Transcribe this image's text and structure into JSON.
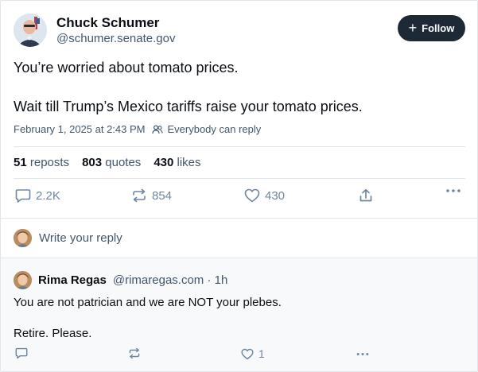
{
  "author": {
    "name": "Chuck Schumer",
    "handle": "@schumer.senate.gov"
  },
  "follow_label": "Follow",
  "post": {
    "line1": "You’re worried about tomato prices.",
    "line2": "Wait till Trump’s Mexico tariffs raise your tomato prices.",
    "timestamp": "February 1, 2025 at 2:43 PM",
    "reply_setting": "Everybody can reply"
  },
  "stats": {
    "reposts_count": "51",
    "reposts_label": "reposts",
    "quotes_count": "803",
    "quotes_label": "quotes",
    "likes_count": "430",
    "likes_label": "likes"
  },
  "actions": {
    "reply_count": "2.2K",
    "repost_count": "854",
    "like_count": "430"
  },
  "reply_prompt": "Write your reply",
  "reply": {
    "name": "Rima Regas",
    "handle": "@rimaregas.com",
    "time": "· 1h",
    "line1": "You are not patrician and we are NOT your plebes.",
    "line2": "Retire. Please.",
    "like_count": "1"
  },
  "icons": {
    "reply": "speech-bubble-icon",
    "repost": "repost-arrows-icon",
    "like": "heart-icon",
    "share": "share-upload-icon",
    "more": "ellipsis-icon",
    "people": "people-icon",
    "plus": "plus-icon"
  },
  "colors": {
    "follow_bg": "#1e2936",
    "muted_text": "#42576c",
    "icon_gray": "#6f869f",
    "reply_bg": "#f7f9fa"
  }
}
